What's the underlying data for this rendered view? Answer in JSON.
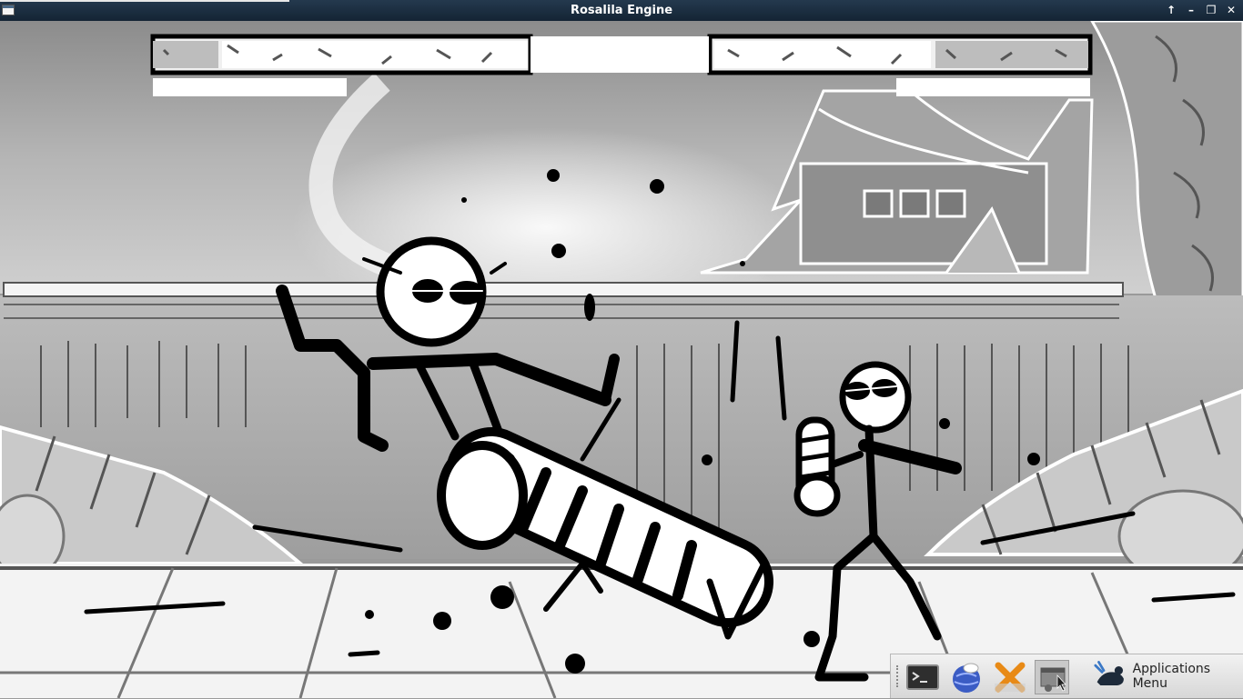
{
  "window": {
    "title": "Rosalila Engine",
    "controls": [
      "shade",
      "minimize",
      "maximize",
      "close"
    ]
  },
  "hud": {
    "player1": {
      "health_fraction": 0.82,
      "power_fraction": 0.0
    },
    "player2": {
      "health_fraction": 0.58,
      "power_fraction": 0.0
    }
  },
  "scene": {
    "stage": "temple courtyard",
    "style": "black and white sketch",
    "fighters": [
      "stickman-sunglasses-left",
      "stickman-sunglasses-right"
    ]
  },
  "taskbar": {
    "launchers": [
      {
        "icon": "terminal-icon"
      },
      {
        "icon": "globe-web-browser-icon"
      },
      {
        "icon": "cross-x-app-icon"
      },
      {
        "icon": "window-switcher-icon"
      }
    ],
    "apps_menu_icon": "mouse-logo-icon",
    "apps_menu_label": "Applications Menu"
  }
}
